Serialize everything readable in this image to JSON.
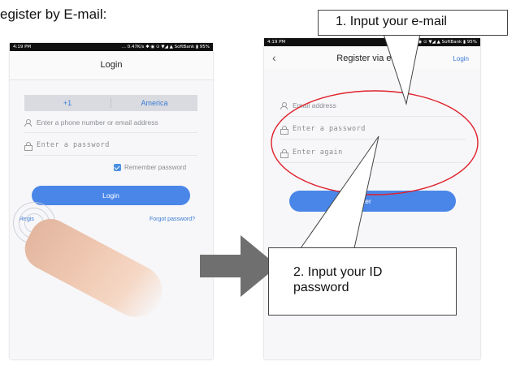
{
  "heading": "egister by E-mail:",
  "left_screen": {
    "status_time": "4:19 PM",
    "status_right": "... 0.47K/s ✱ ◉ ⊙ ▼◢ ▲ SoftBank ▮ 95%",
    "title": "Login",
    "country_code": "+1",
    "country_name": "America",
    "phone_placeholder": "Enter a phone number or email address",
    "password_placeholder": "Enter a password",
    "remember_label": "Remember password",
    "login_button": "Login",
    "register_link": "Regis",
    "forgot_link": "Forgot password?"
  },
  "right_screen": {
    "status_time": "4:19 PM",
    "status_right": "... 0.14K/s ✱ ◉ ⊙ ▼◢ ▲ SoftBank ▮ 95%",
    "back_icon": "‹",
    "title": "Register via email",
    "login_link": "Login",
    "email_placeholder": "Email address",
    "password_placeholder": "Enter a password",
    "again_placeholder": "Enter again",
    "register_button": "gister"
  },
  "callouts": {
    "step1": "1. Input your e-mail",
    "step2": "2. Input your ID password"
  },
  "colors": {
    "accent": "#4a86e8",
    "annotation": "#e0202a",
    "arrow": "#6f6f6f"
  }
}
